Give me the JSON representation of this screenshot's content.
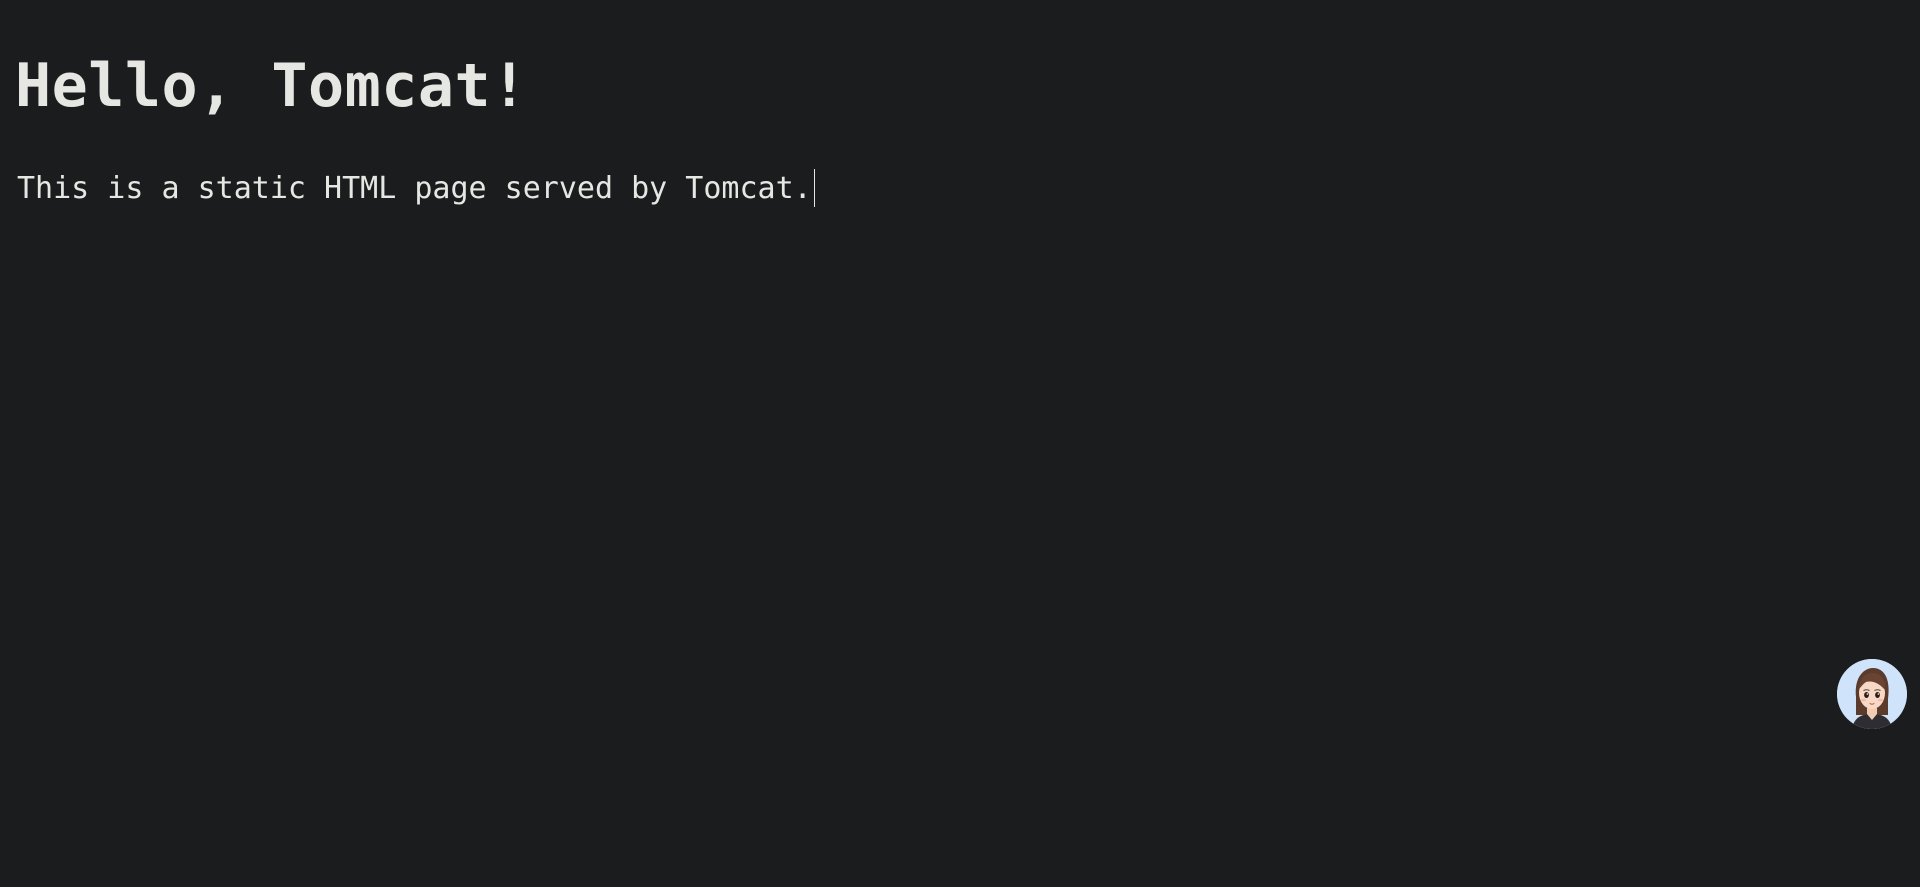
{
  "main": {
    "heading": "Hello, Tomcat!",
    "paragraph": "This is a static HTML page served by Tomcat."
  },
  "assistant": {
    "icon": "avatar-icon",
    "background_color": "#cfe3fb"
  },
  "colors": {
    "background": "#1b1c1e",
    "text": "#e6e6e3"
  }
}
